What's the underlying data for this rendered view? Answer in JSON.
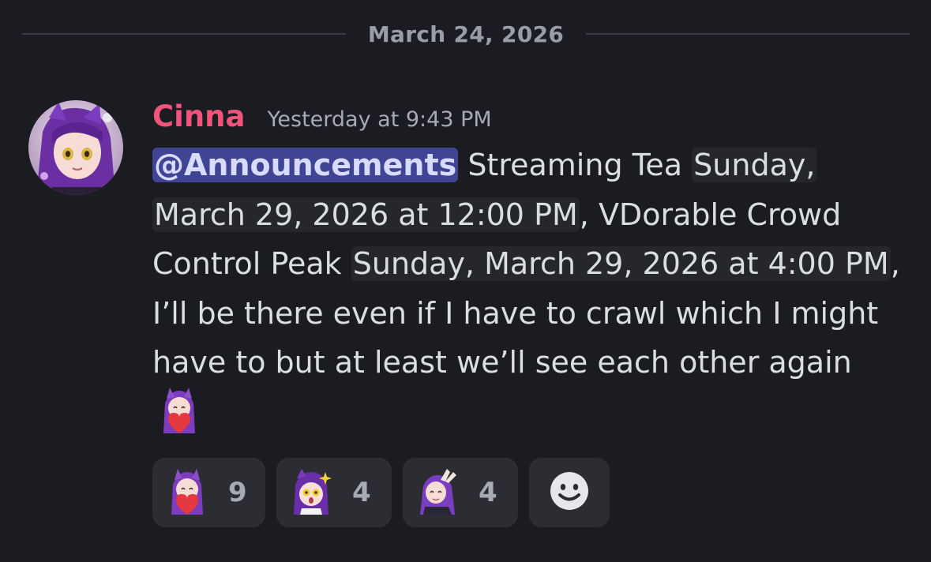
{
  "divider": {
    "date": "March 24, 2026"
  },
  "message": {
    "author": "Cinna",
    "timestamp": "Yesterday at 9:43 PM",
    "author_color": "#f0547a",
    "mention": "@Announcements",
    "text_1": " Streaming Tea ",
    "ts_1": "Sunday, March 29, 2026 at 12:00 PM",
    "text_2": ", VDorable Crowd Control Peak ",
    "ts_2": "Sunday, March 29, 2026 at 4:00 PM",
    "text_3": ", I’ll be there even if I have to crawl which I might have to but at least we’ll see each other again ",
    "inline_emoji": "heart-hug-emoji"
  },
  "reactions": [
    {
      "emoji": "heart-hug-emoji",
      "count": "9"
    },
    {
      "emoji": "shocked-sparkle-emoji",
      "count": "4"
    },
    {
      "emoji": "bunny-ears-emoji",
      "count": "4"
    }
  ],
  "add_reaction_icon": "smiley-add-reaction-icon",
  "colors": {
    "background": "#1b1c21",
    "mention_bg": "#3f4493",
    "timestamp_bg": "#26272c",
    "reaction_bg": "#2b2d33"
  }
}
